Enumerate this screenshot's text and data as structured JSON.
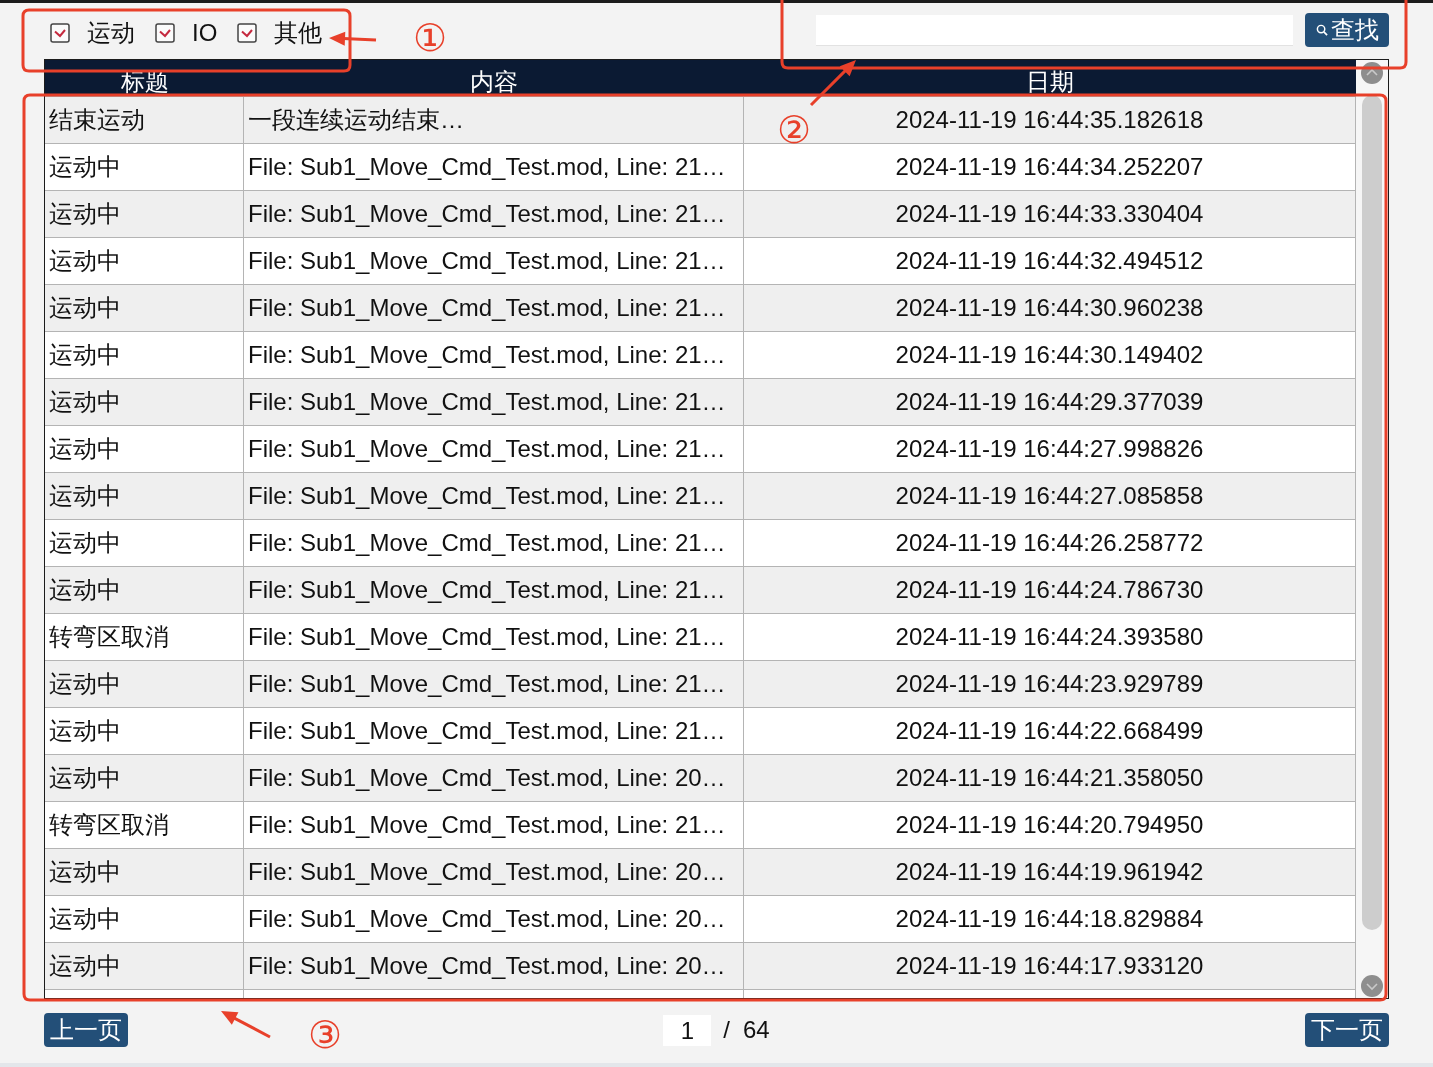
{
  "filters": [
    {
      "label": "运动",
      "checked": true
    },
    {
      "label": "IO",
      "checked": true
    },
    {
      "label": "其他",
      "checked": true
    }
  ],
  "search": {
    "button": "查找"
  },
  "table": {
    "columns": [
      "标题",
      "内容",
      "日期"
    ],
    "rows": [
      {
        "title": "结束运动",
        "content": "一段连续运动结束…",
        "date": "2024-11-19 16:44:35.182618"
      },
      {
        "title": "运动中",
        "content": "File: Sub1_Move_Cmd_Test.mod, Line: 21…",
        "date": "2024-11-19 16:44:34.252207"
      },
      {
        "title": "运动中",
        "content": "File: Sub1_Move_Cmd_Test.mod, Line: 21…",
        "date": "2024-11-19 16:44:33.330404"
      },
      {
        "title": "运动中",
        "content": "File: Sub1_Move_Cmd_Test.mod, Line: 21…",
        "date": "2024-11-19 16:44:32.494512"
      },
      {
        "title": "运动中",
        "content": "File: Sub1_Move_Cmd_Test.mod, Line: 21…",
        "date": "2024-11-19 16:44:30.960238"
      },
      {
        "title": "运动中",
        "content": "File: Sub1_Move_Cmd_Test.mod, Line: 21…",
        "date": "2024-11-19 16:44:30.149402"
      },
      {
        "title": "运动中",
        "content": "File: Sub1_Move_Cmd_Test.mod, Line: 21…",
        "date": "2024-11-19 16:44:29.377039"
      },
      {
        "title": "运动中",
        "content": "File: Sub1_Move_Cmd_Test.mod, Line: 21…",
        "date": "2024-11-19 16:44:27.998826"
      },
      {
        "title": "运动中",
        "content": "File: Sub1_Move_Cmd_Test.mod, Line: 21…",
        "date": "2024-11-19 16:44:27.085858"
      },
      {
        "title": "运动中",
        "content": "File: Sub1_Move_Cmd_Test.mod, Line: 21…",
        "date": "2024-11-19 16:44:26.258772"
      },
      {
        "title": "运动中",
        "content": "File: Sub1_Move_Cmd_Test.mod, Line: 21…",
        "date": "2024-11-19 16:44:24.786730"
      },
      {
        "title": "转弯区取消",
        "content": "File: Sub1_Move_Cmd_Test.mod, Line: 21…",
        "date": "2024-11-19 16:44:24.393580"
      },
      {
        "title": "运动中",
        "content": "File: Sub1_Move_Cmd_Test.mod, Line: 21…",
        "date": "2024-11-19 16:44:23.929789"
      },
      {
        "title": "运动中",
        "content": "File: Sub1_Move_Cmd_Test.mod, Line: 21…",
        "date": "2024-11-19 16:44:22.668499"
      },
      {
        "title": "运动中",
        "content": "File: Sub1_Move_Cmd_Test.mod, Line: 20…",
        "date": "2024-11-19 16:44:21.358050"
      },
      {
        "title": "转弯区取消",
        "content": "File: Sub1_Move_Cmd_Test.mod, Line: 21…",
        "date": "2024-11-19 16:44:20.794950"
      },
      {
        "title": "运动中",
        "content": "File: Sub1_Move_Cmd_Test.mod, Line: 20…",
        "date": "2024-11-19 16:44:19.961942"
      },
      {
        "title": "运动中",
        "content": "File: Sub1_Move_Cmd_Test.mod, Line: 20…",
        "date": "2024-11-19 16:44:18.829884"
      },
      {
        "title": "运动中",
        "content": "File: Sub1_Move_Cmd_Test.mod, Line: 20…",
        "date": "2024-11-19 16:44:17.933120"
      }
    ]
  },
  "pagination": {
    "previous": "上一页",
    "page": "1",
    "separator": "/",
    "total": "64",
    "next": "下一页"
  },
  "annotations": [
    {
      "label": "①"
    },
    {
      "label": "②"
    },
    {
      "label": "③"
    }
  ]
}
